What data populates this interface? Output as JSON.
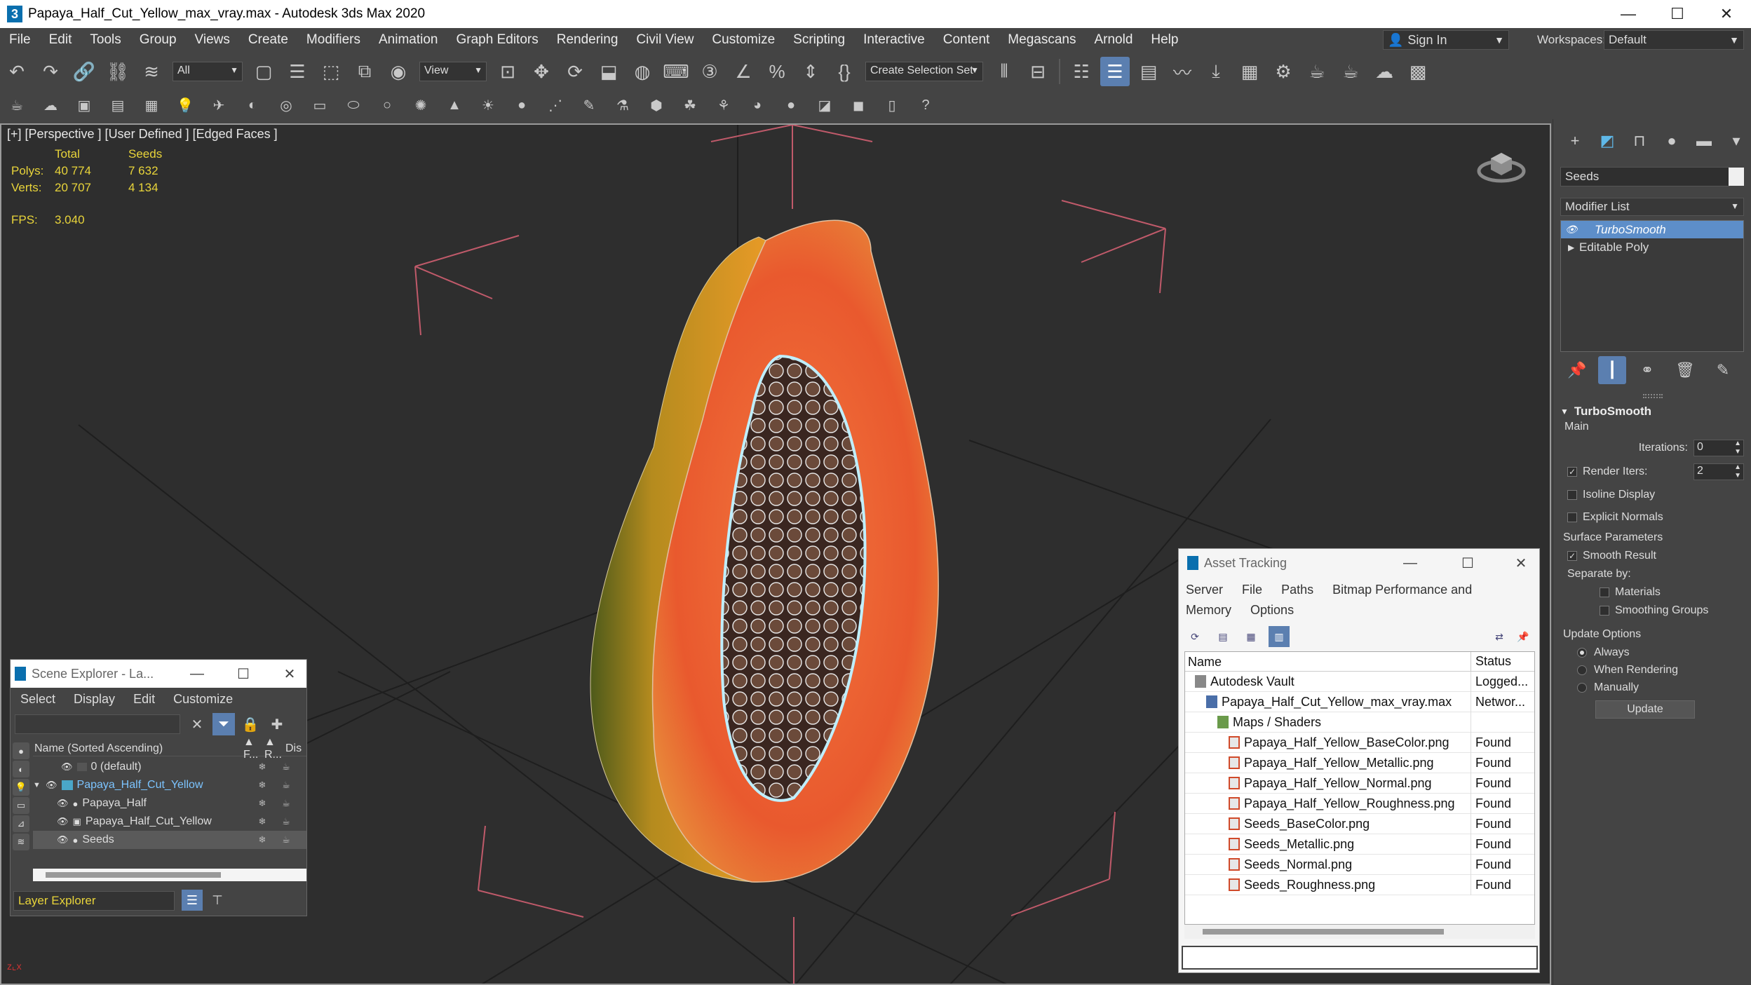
{
  "window": {
    "title": "Papaya_Half_Cut_Yellow_max_vray.max - Autodesk 3ds Max 2020",
    "logo_glyph": "3",
    "minimize": "—",
    "maximize": "☐",
    "close": "✕"
  },
  "menu": [
    "File",
    "Edit",
    "Tools",
    "Group",
    "Views",
    "Create",
    "Modifiers",
    "Animation",
    "Graph Editors",
    "Rendering",
    "Civil View",
    "Customize",
    "Scripting",
    "Interactive",
    "Content",
    "Megascans",
    "Arnold",
    "Help"
  ],
  "account": {
    "sign_in": "Sign In",
    "workspaces_label": "Workspaces:",
    "workspace": "Default"
  },
  "toolbar": {
    "filter_select": "All",
    "ref_coord_select": "View",
    "selection_set": "Create Selection Set"
  },
  "viewport": {
    "label": "[+] [Perspective ] [User Defined ] [Edged Faces ]",
    "stats_headers": [
      "Total",
      "Seeds"
    ],
    "stats": [
      {
        "label": "Polys:",
        "total": "40 774",
        "seeds": "7 632"
      },
      {
        "label": "Verts:",
        "total": "20 707",
        "seeds": "4 134"
      }
    ],
    "fps_label": "FPS:",
    "fps_value": "3.040"
  },
  "command_panel": {
    "object_name": "Seeds",
    "modifier_list": "Modifier List",
    "stack": [
      {
        "name": "TurboSmooth",
        "selected": true
      },
      {
        "name": "Editable Poly",
        "selected": false
      }
    ],
    "rollout": {
      "title": "TurboSmooth",
      "main": "Main",
      "iterations_label": "Iterations:",
      "iterations": "0",
      "render_iters_label": "Render Iters:",
      "render_iters": "2",
      "isoline": "Isoline Display",
      "explicit_normals": "Explicit Normals",
      "surface_params": "Surface Parameters",
      "smooth_result": "Smooth Result",
      "separate_by": "Separate by:",
      "materials": "Materials",
      "smoothing_groups": "Smoothing Groups",
      "update_options": "Update Options",
      "always": "Always",
      "when_rendering": "When Rendering",
      "manually": "Manually",
      "update_button": "Update"
    }
  },
  "scene_explorer": {
    "title": "Scene Explorer - La...",
    "menu": [
      "Select",
      "Display",
      "Edit",
      "Customize"
    ],
    "col_name": "Name (Sorted Ascending)",
    "col_f": "▲ F...",
    "col_r": "▲ R...",
    "col_dis": "Dis",
    "rows": [
      {
        "name": "0 (default)",
        "indent": 40,
        "selected": false
      },
      {
        "name": "Papaya_Half_Cut_Yellow",
        "indent": 0,
        "selected": false,
        "highlight": true
      },
      {
        "name": "Papaya_Half",
        "indent": 22,
        "selected": false
      },
      {
        "name": "Papaya_Half_Cut_Yellow",
        "indent": 22,
        "selected": false
      },
      {
        "name": "Seeds",
        "indent": 22,
        "selected": true
      }
    ],
    "footer": "Layer Explorer"
  },
  "asset_tracking": {
    "title": "Asset Tracking",
    "menu": [
      "Server",
      "File",
      "Paths",
      "Bitmap Performance and Memory",
      "Options"
    ],
    "col_name": "Name",
    "col_status": "Status",
    "rows": [
      {
        "name": "Autodesk Vault",
        "status": "Logged...",
        "icon": "vault",
        "indent": 14
      },
      {
        "name": "Papaya_Half_Cut_Yellow_max_vray.max",
        "status": "Networ...",
        "icon": "max",
        "indent": 30
      },
      {
        "name": "Maps / Shaders",
        "status": "",
        "icon": "folder",
        "indent": 46
      },
      {
        "name": "Papaya_Half_Yellow_BaseColor.png",
        "status": "Found",
        "icon": "img",
        "indent": 62
      },
      {
        "name": "Papaya_Half_Yellow_Metallic.png",
        "status": "Found",
        "icon": "img",
        "indent": 62
      },
      {
        "name": "Papaya_Half_Yellow_Normal.png",
        "status": "Found",
        "icon": "img",
        "indent": 62
      },
      {
        "name": "Papaya_Half_Yellow_Roughness.png",
        "status": "Found",
        "icon": "img",
        "indent": 62
      },
      {
        "name": "Seeds_BaseColor.png",
        "status": "Found",
        "icon": "img",
        "indent": 62
      },
      {
        "name": "Seeds_Metallic.png",
        "status": "Found",
        "icon": "img",
        "indent": 62
      },
      {
        "name": "Seeds_Normal.png",
        "status": "Found",
        "icon": "img",
        "indent": 62
      },
      {
        "name": "Seeds_Roughness.png",
        "status": "Found",
        "icon": "img",
        "indent": 62
      }
    ]
  },
  "colors": {
    "accent": "#5b7fb0",
    "stats": "#e8d43a",
    "viewport_bg": "#2e2e2e",
    "panel_bg": "#444444"
  }
}
